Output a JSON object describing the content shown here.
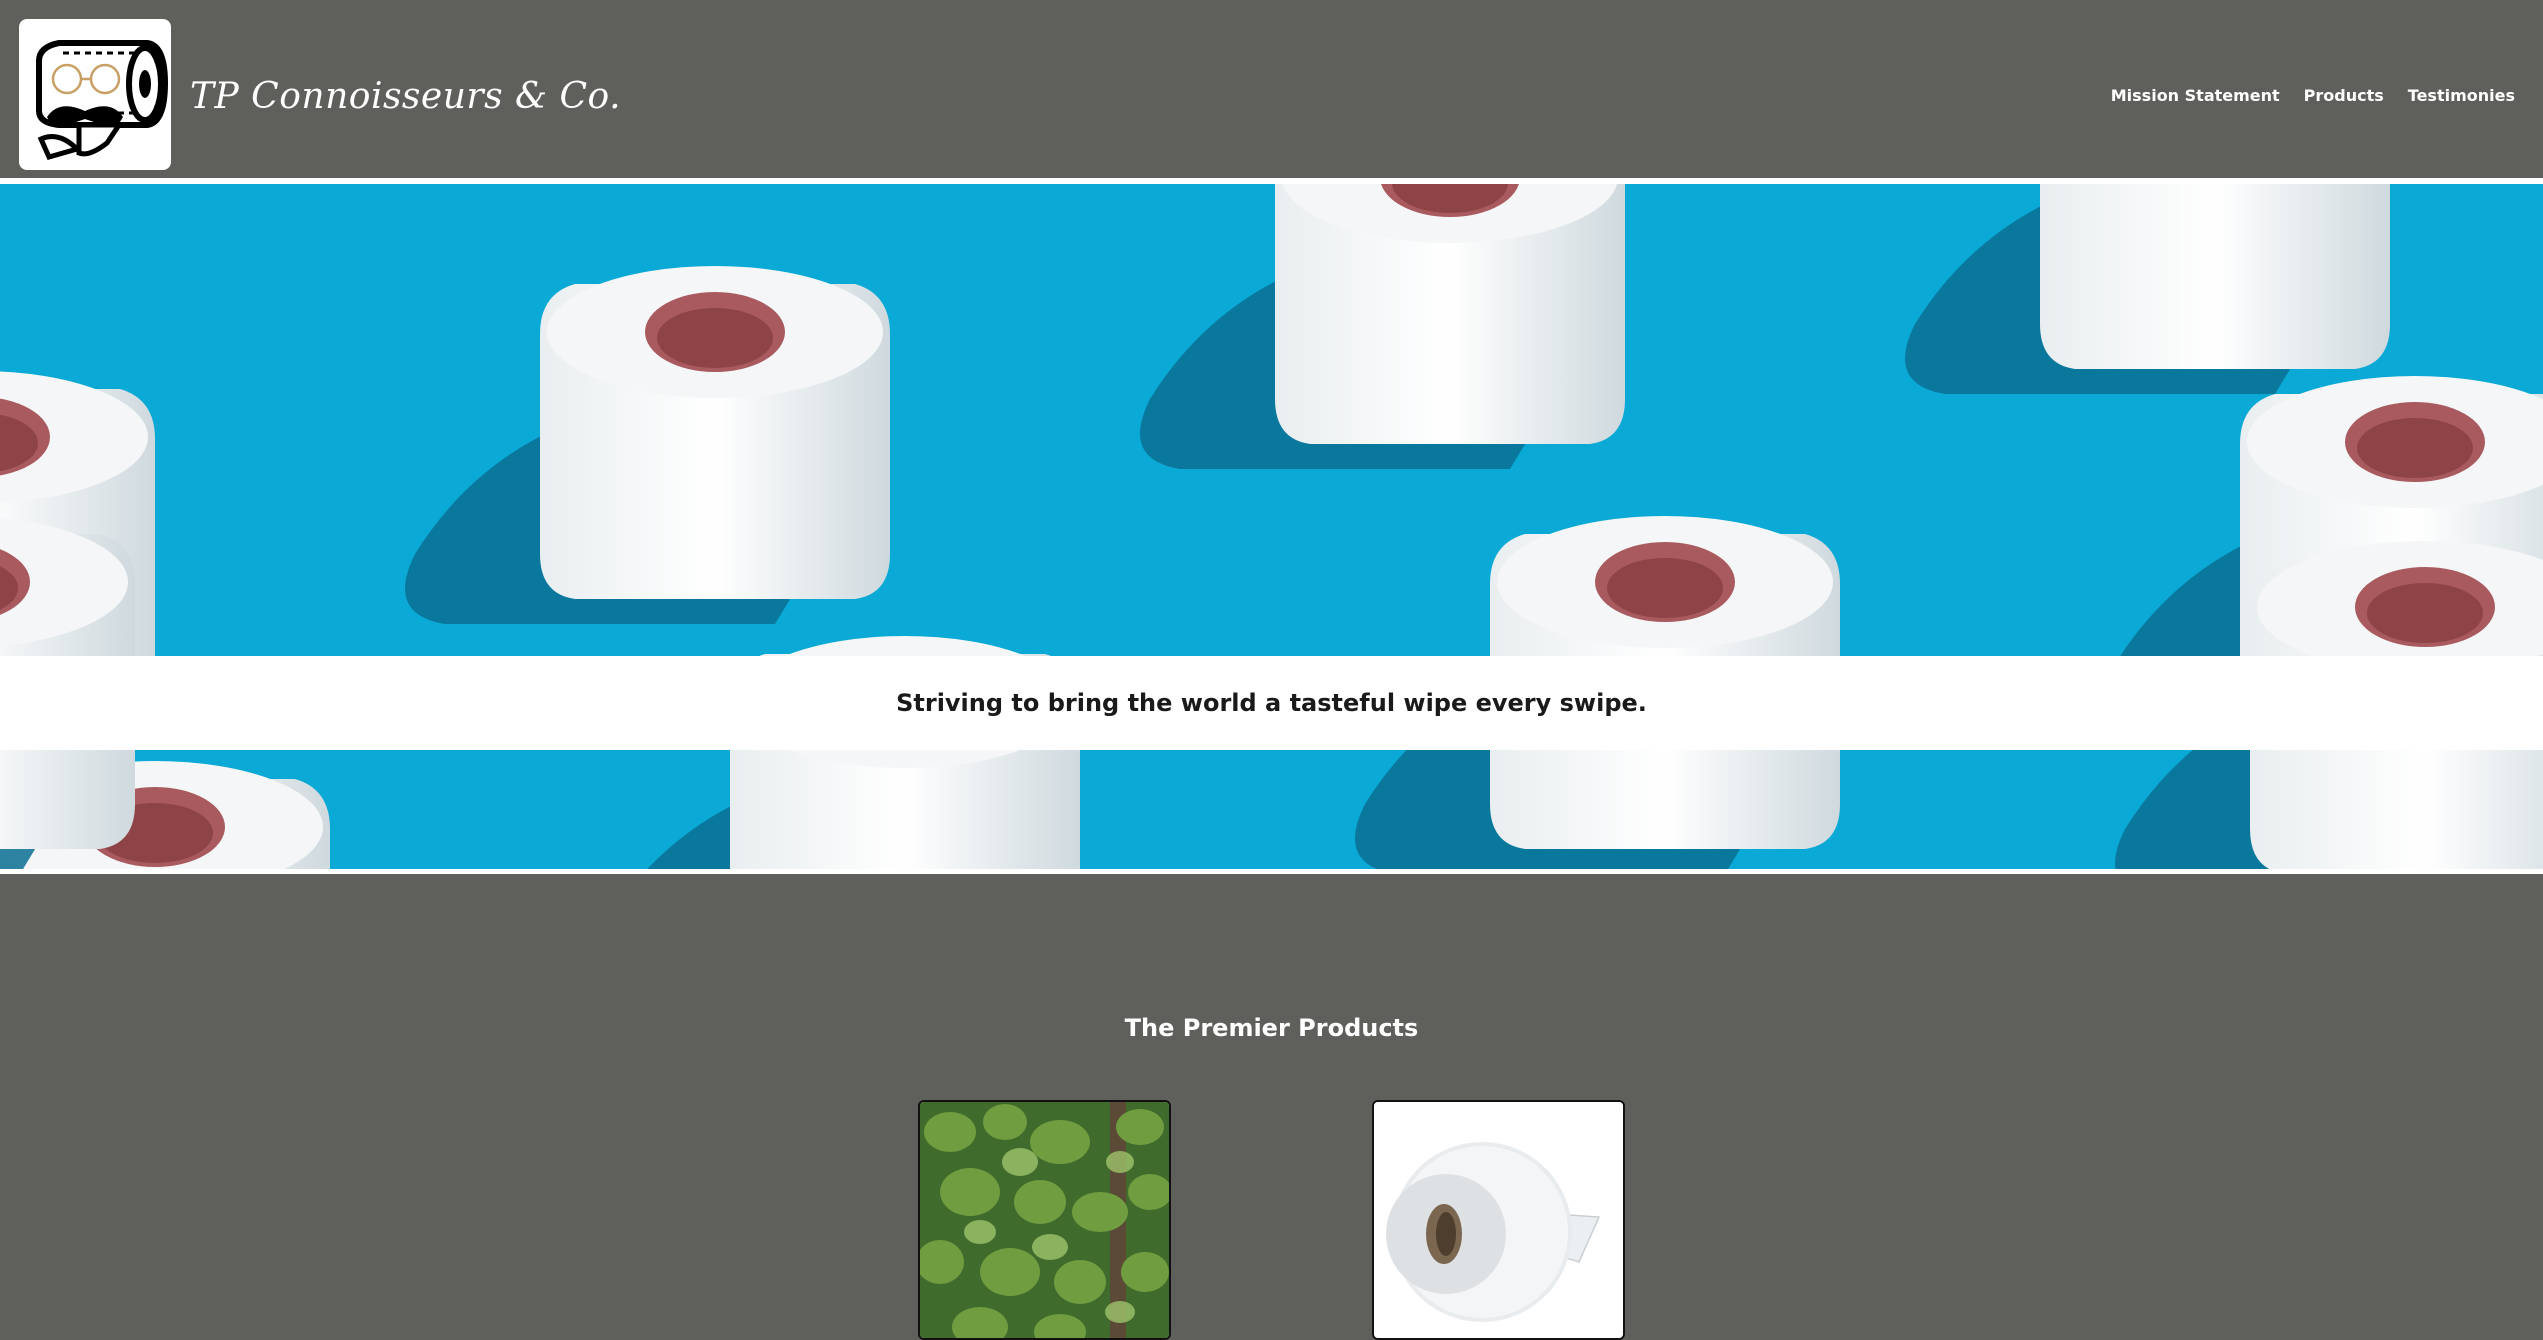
{
  "header": {
    "brand_name": "TP Connoisseurs & Co.",
    "logo_icon": "mustache-toilet-roll-logo",
    "nav": [
      {
        "label": "Mission Statement"
      },
      {
        "label": "Products"
      },
      {
        "label": "Testimonies"
      }
    ]
  },
  "hero": {
    "image": "toilet-paper-rolls-pattern",
    "tagline": "Striving to bring the world a tasteful wipe every swipe.",
    "background_color": "#0aa9d6"
  },
  "products": {
    "title": "The Premier Products",
    "items": [
      {
        "image": "green-leaves-image"
      },
      {
        "image": "jumbo-toilet-roll-image"
      }
    ]
  },
  "colors": {
    "page_background": "#5f5f5b",
    "accent": "#0aa9d6",
    "text_light": "#ffffff",
    "text_dark": "#1a1a1a"
  }
}
